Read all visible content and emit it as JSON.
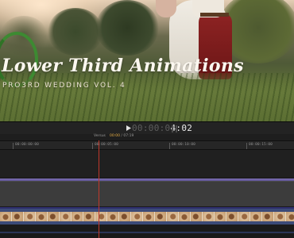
{
  "viewer": {
    "title_main": "Lower Third Animations",
    "title_sub": "PRO3RD WEDDING VOL. 4"
  },
  "transport": {
    "timecode_dim": "00:00:0",
    "timecode_bright": "4:02",
    "play_icon": "play-icon",
    "fullscreen_icon": "fullscreen-icon"
  },
  "timeline_info": {
    "clip_name": "Versus",
    "duration_current": "00:00",
    "duration_separator": " / ",
    "duration_total": "07:19"
  },
  "ruler": {
    "labels": [
      "00:00:00:00",
      "00:00:05:00",
      "00:00:10:00",
      "00:00:15:00"
    ]
  },
  "colors": {
    "playhead": "#c0382b",
    "connection_line": "#7d6fb4",
    "video_clip": "#3b4a78",
    "accent_timecode": "#e8b046"
  }
}
